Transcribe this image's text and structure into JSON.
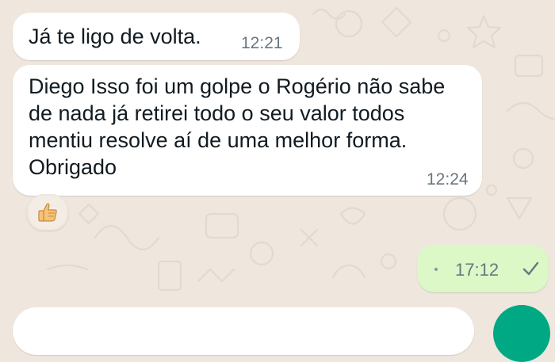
{
  "chat": {
    "messages": [
      {
        "direction": "incoming",
        "text": "Já te ligo de volta.",
        "time": "12:21"
      },
      {
        "direction": "incoming",
        "text": "Diego Isso foi um golpe o Rogério não sabe de nada já retirei todo o seu valor todos mentiu resolve aí de uma melhor forma. Obrigado",
        "time": "12:24",
        "reaction": "thumbs-up"
      },
      {
        "direction": "outgoing",
        "text": "",
        "time": "17:12",
        "status": "sent"
      }
    ]
  },
  "composer": {
    "text": ""
  },
  "colors": {
    "wallpaper": "#efe7de",
    "incoming_bubble": "#ffffff",
    "outgoing_bubble": "#dbf8c6",
    "accent": "#00a884",
    "timestamp": "#667781"
  },
  "icons": {
    "reaction": "thumbs-up-icon",
    "status": "single-check-icon",
    "send": "mic-icon"
  }
}
